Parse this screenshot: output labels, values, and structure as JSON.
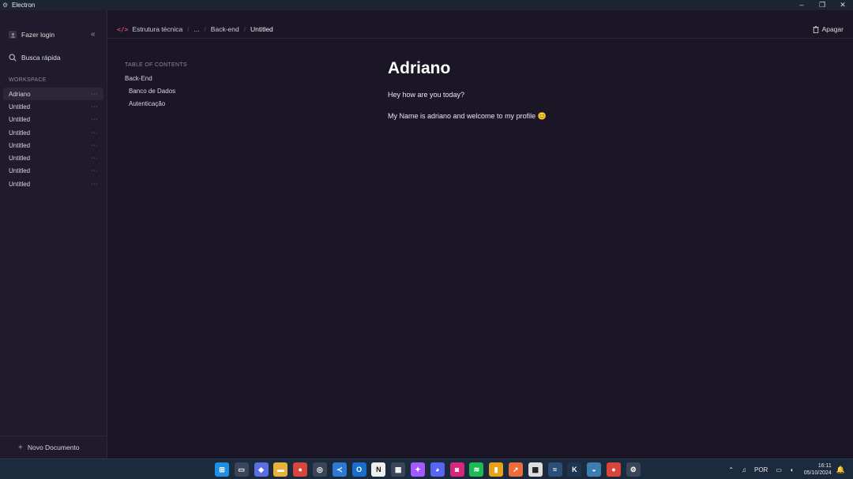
{
  "window": {
    "title": "Electron"
  },
  "sidebar": {
    "login_label": "Fazer login",
    "search_label": "Busca rápida",
    "workspace_label": "WORKSPACE",
    "items": [
      {
        "label": "Adriano",
        "more": "···"
      },
      {
        "label": "Untitled",
        "more": "···"
      },
      {
        "label": "Untitled",
        "more": "···"
      },
      {
        "label": "Untitled",
        "more": "···"
      },
      {
        "label": "Untitled",
        "more": "···"
      },
      {
        "label": "Untitled",
        "more": "···"
      },
      {
        "label": "Untitled",
        "more": "···"
      },
      {
        "label": "Untitled",
        "more": "···"
      }
    ],
    "new_document_label": "Novo Documento"
  },
  "breadcrumb": {
    "items": [
      "Estrutura técnica",
      "...",
      "Back-end",
      "Untitled"
    ]
  },
  "toolbar": {
    "delete_label": "Apagar"
  },
  "toc": {
    "title": "TABLE OF CONTENTS",
    "items": [
      {
        "label": "Back-End",
        "level": 1
      },
      {
        "label": "Banco de Dados",
        "level": 2
      },
      {
        "label": "Autenticação",
        "level": 2
      }
    ]
  },
  "document": {
    "title": "Adriano",
    "paragraphs": [
      "Hey how are you today?",
      "My Name is adriano and welcome to my profile 😊"
    ]
  },
  "taskbar": {
    "language": "POR",
    "time": "16:11",
    "date": "05/10/2024"
  }
}
